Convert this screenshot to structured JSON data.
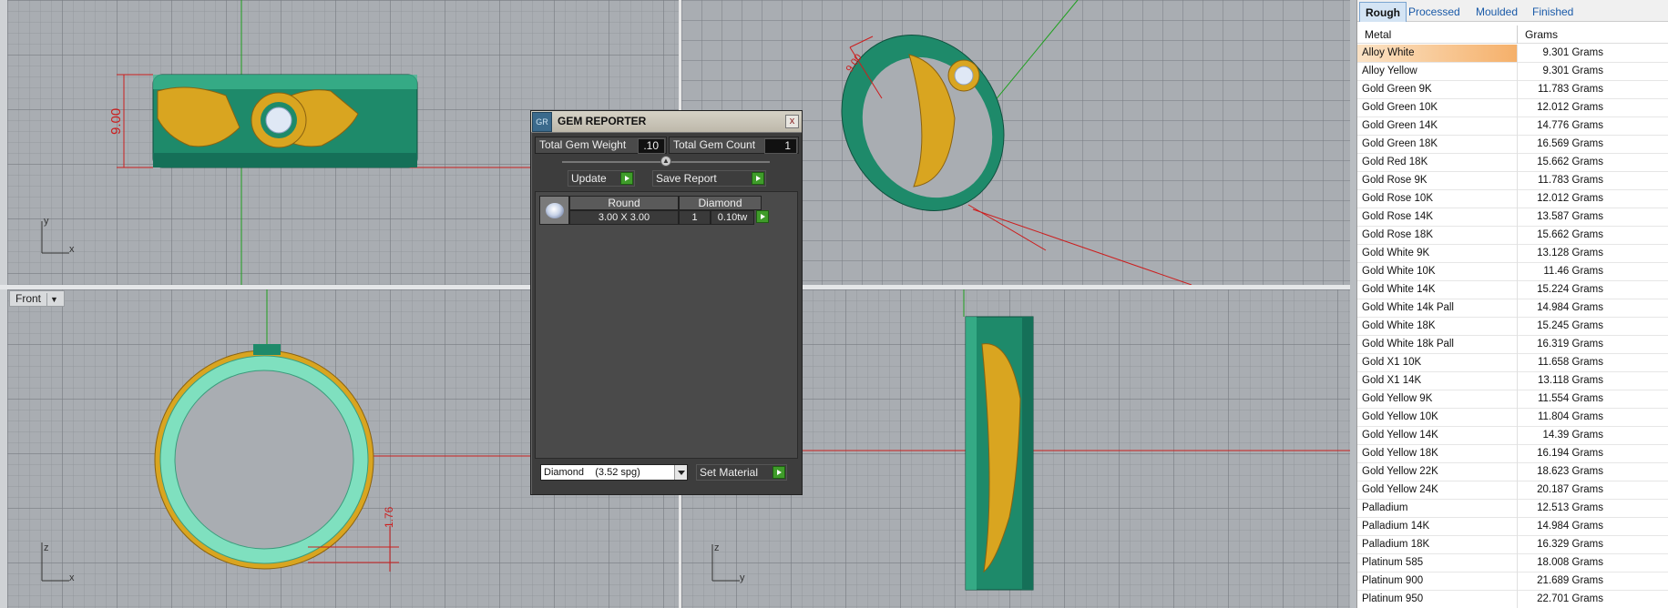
{
  "viewports": {
    "front_label": "Front",
    "top": {
      "axis_y": "y",
      "axis_x": "x",
      "dim_label": "9.00"
    },
    "persp": {
      "dim_label": "9.00"
    },
    "front": {
      "axis_z": "z",
      "axis_x": "x",
      "dim_label": "1.76"
    },
    "right": {
      "axis_z": "z",
      "axis_y": "y"
    }
  },
  "gem_reporter": {
    "logo": "GR",
    "title": "GEM REPORTER",
    "close": "x",
    "total_weight_label": "Total Gem Weight",
    "total_weight_value": ".10",
    "total_count_label": "Total Gem Count",
    "total_count_value": "1",
    "update_label": "Update",
    "save_report_label": "Save Report",
    "table": {
      "headers": [
        "Round",
        "Diamond"
      ],
      "row": {
        "size": "3.00 X 3.00",
        "count": "1",
        "weight": "0.10tw"
      }
    },
    "material_select": "Diamond    (3.52 spg)",
    "set_material_label": "Set Material"
  },
  "panel": {
    "tabs": [
      "Rough",
      "Processed",
      "Moulded",
      "Finished"
    ],
    "active_tab": "Rough",
    "col_metal": "Metal",
    "col_grams": "Grams",
    "rows": [
      {
        "metal": "Alloy White",
        "grams": "9.301 Grams"
      },
      {
        "metal": "Alloy Yellow",
        "grams": "9.301 Grams"
      },
      {
        "metal": "Gold Green 9K",
        "grams": "11.783 Grams"
      },
      {
        "metal": "Gold Green 10K",
        "grams": "12.012 Grams"
      },
      {
        "metal": "Gold Green 14K",
        "grams": "14.776 Grams"
      },
      {
        "metal": "Gold Green 18K",
        "grams": "16.569 Grams"
      },
      {
        "metal": "Gold Red 18K",
        "grams": "15.662 Grams"
      },
      {
        "metal": "Gold Rose 9K",
        "grams": "11.783 Grams"
      },
      {
        "metal": "Gold Rose 10K",
        "grams": "12.012 Grams"
      },
      {
        "metal": "Gold Rose 14K",
        "grams": "13.587 Grams"
      },
      {
        "metal": "Gold Rose 18K",
        "grams": "15.662 Grams"
      },
      {
        "metal": "Gold White 9K",
        "grams": "13.128 Grams"
      },
      {
        "metal": "Gold White 10K",
        "grams": "11.46 Grams"
      },
      {
        "metal": "Gold White 14K",
        "grams": "15.224 Grams"
      },
      {
        "metal": "Gold White 14k Pall",
        "grams": "14.984 Grams"
      },
      {
        "metal": "Gold White 18K",
        "grams": "15.245 Grams"
      },
      {
        "metal": "Gold White 18k Pall",
        "grams": "16.319 Grams"
      },
      {
        "metal": "Gold X1 10K",
        "grams": "11.658 Grams"
      },
      {
        "metal": "Gold X1 14K",
        "grams": "13.118 Grams"
      },
      {
        "metal": "Gold Yellow 9K",
        "grams": "11.554 Grams"
      },
      {
        "metal": "Gold Yellow 10K",
        "grams": "11.804 Grams"
      },
      {
        "metal": "Gold Yellow 14K",
        "grams": "14.39 Grams"
      },
      {
        "metal": "Gold Yellow 18K",
        "grams": "16.194 Grams"
      },
      {
        "metal": "Gold Yellow 22K",
        "grams": "18.623 Grams"
      },
      {
        "metal": "Gold Yellow 24K",
        "grams": "20.187 Grams"
      },
      {
        "metal": "Palladium",
        "grams": "12.513 Grams"
      },
      {
        "metal": "Palladium 14K",
        "grams": "14.984 Grams"
      },
      {
        "metal": "Palladium 18K",
        "grams": "16.329 Grams"
      },
      {
        "metal": "Platinum 585",
        "grams": "18.008 Grams"
      },
      {
        "metal": "Platinum 900",
        "grams": "21.689 Grams"
      },
      {
        "metal": "Platinum 950",
        "grams": "22.701 Grams"
      }
    ],
    "selected_row": "Alloy White"
  },
  "colors": {
    "ring_green": "#1e8a6a",
    "gold": "#d9a520",
    "dimension_red": "#cc1e1e",
    "axis_green": "#1ea01e",
    "selection_orange": "#f5b06a"
  }
}
